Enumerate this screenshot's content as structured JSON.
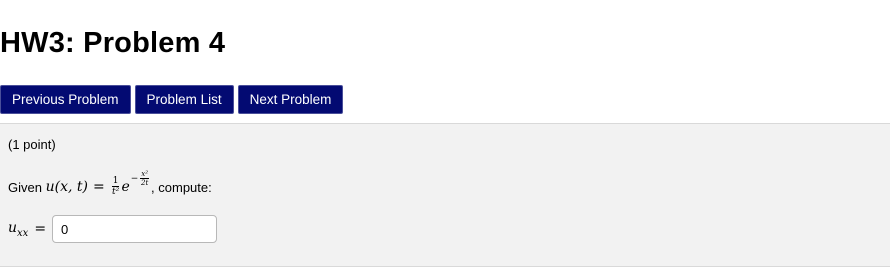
{
  "title": "HW3: Problem 4",
  "nav": {
    "previous_label": "Previous Problem",
    "list_label": "Problem List",
    "next_label": "Next Problem"
  },
  "problem": {
    "points": "(1 point)",
    "given_prefix": "Given",
    "func_lhs": "u(x, t)",
    "equals": "=",
    "frac_num": "1",
    "frac_den": "t²",
    "base": "e",
    "exp_minus": "−",
    "exp_num": "x²",
    "exp_den": "2t",
    "given_suffix": ", compute:",
    "answer_var": "u",
    "answer_sub": "xx",
    "answer_value": "0"
  },
  "colors": {
    "button_bg": "#030a72",
    "panel_bg": "#f2f2f2"
  }
}
